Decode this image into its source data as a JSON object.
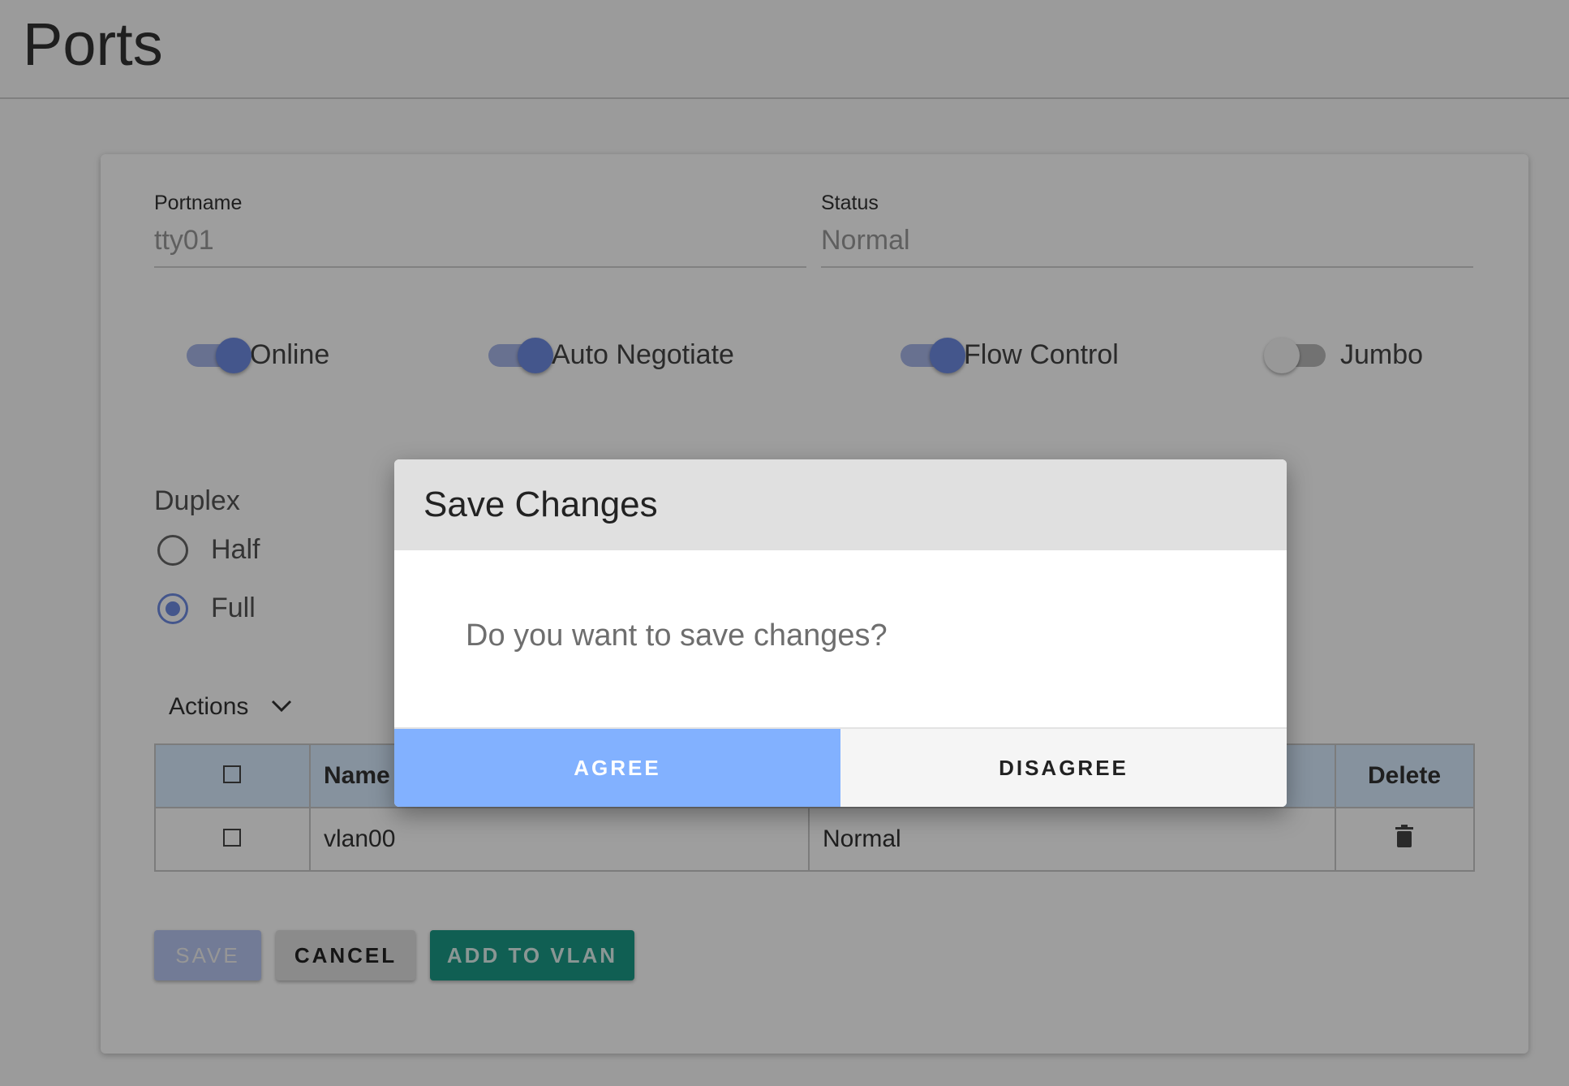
{
  "page": {
    "title": "Ports"
  },
  "form": {
    "portname": {
      "label": "Portname",
      "value": "tty01"
    },
    "status": {
      "label": "Status",
      "value": "Normal"
    },
    "toggles": [
      {
        "label": "Online",
        "on": true
      },
      {
        "label": "Auto Negotiate",
        "on": true
      },
      {
        "label": "Flow Control",
        "on": true
      },
      {
        "label": "Jumbo",
        "on": false
      }
    ],
    "duplex": {
      "label": "Duplex",
      "options": [
        {
          "label": "Half",
          "checked": false
        },
        {
          "label": "Full",
          "checked": true
        }
      ]
    },
    "actions_label": "Actions"
  },
  "table": {
    "headers": {
      "name": "Name",
      "delete": "Delete"
    },
    "rows": [
      {
        "name": "vlan00",
        "status": "Normal"
      }
    ]
  },
  "buttons": {
    "save": "SAVE",
    "cancel": "CANCEL",
    "add_to_vlan": "ADD TO VLAN"
  },
  "dialog": {
    "title": "Save Changes",
    "message": "Do you want to save changes?",
    "agree": "AGREE",
    "disagree": "DISAGREE"
  },
  "icons": {
    "actions": "chevron-down-icon",
    "delete": "trash-icon"
  },
  "colors": {
    "primary": "#6f8ce3",
    "agree": "#82b1ff",
    "teal": "#1b9987",
    "table_header": "#d9ecff"
  }
}
